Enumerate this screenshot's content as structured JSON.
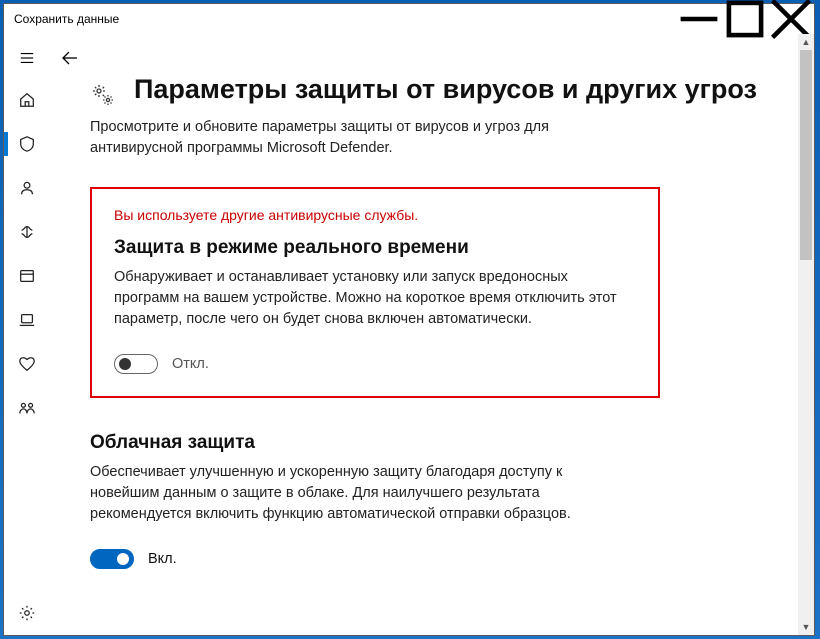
{
  "window": {
    "title": "Сохранить данные"
  },
  "page": {
    "heading": "Параметры защиты от вирусов и других угроз",
    "subtitle": "Просмотрите и обновите параметры защиты от вирусов и угроз для антивирусной программы Microsoft Defender."
  },
  "realtime": {
    "warning": "Вы используете другие антивирусные службы.",
    "title": "Защита в режиме реального времени",
    "desc": "Обнаруживает и останавливает установку или запуск вредоносных программ на вашем устройстве. Можно на короткое время отключить этот параметр, после чего он будет снова включен автоматически.",
    "state_label": "Откл.",
    "on": false
  },
  "cloud": {
    "title": "Облачная защита",
    "desc": "Обеспечивает улучшенную и ускоренную защиту благодаря доступу к новейшим данным о защите в облаке. Для наилучшего результата рекомендуется включить функцию автоматической отправки образцов.",
    "state_label": "Вкл.",
    "on": true
  }
}
